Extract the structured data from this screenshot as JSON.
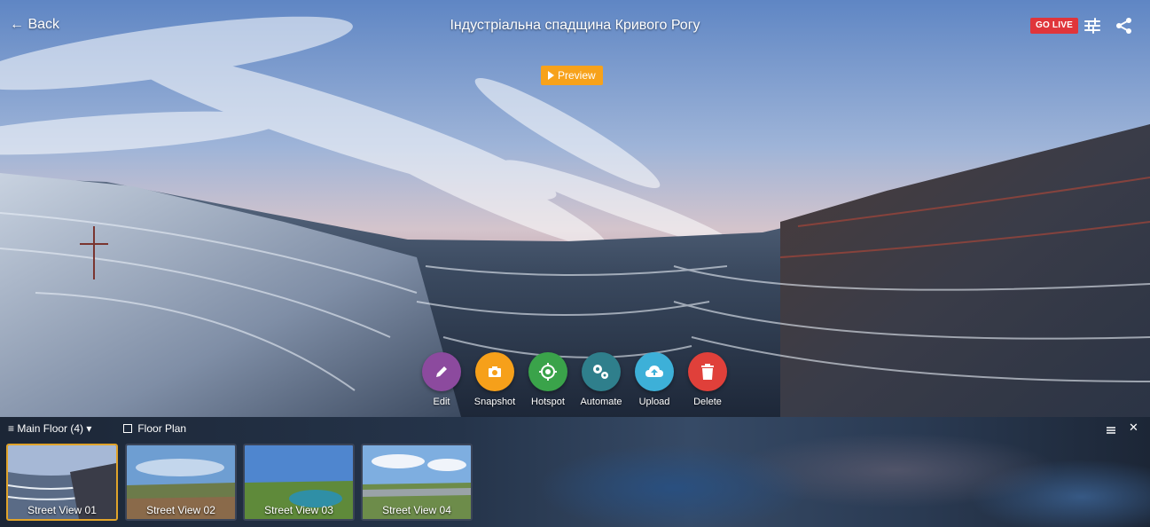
{
  "header": {
    "back_label": "← Back",
    "title": "Індустріальна спадщина Кривого Рогу",
    "go_live_label": "GO LIVE"
  },
  "preview_label": "Preview",
  "actions": [
    {
      "label": "Edit",
      "icon": "pencil-icon",
      "color": "#8c4a9e"
    },
    {
      "label": "Snapshot",
      "icon": "camera-icon",
      "color": "#f6a01a"
    },
    {
      "label": "Hotspot",
      "icon": "target-icon",
      "color": "#3aa34a"
    },
    {
      "label": "Automate",
      "icon": "gears-icon",
      "color": "#2f7f8c"
    },
    {
      "label": "Upload",
      "icon": "cloud-upload-icon",
      "color": "#3db0d8"
    },
    {
      "label": "Delete",
      "icon": "trash-icon",
      "color": "#e0403a"
    }
  ],
  "panel": {
    "floor_select_label": "Main Floor (4)",
    "floor_plan_label": "Floor Plan",
    "thumbnails": [
      {
        "label": "Street View 01",
        "active": true
      },
      {
        "label": "Street View 02",
        "active": false
      },
      {
        "label": "Street View 03",
        "active": false
      },
      {
        "label": "Street View 04",
        "active": false
      }
    ]
  },
  "colors": {
    "go_live": "#e0353b",
    "preview": "#f7a21b",
    "active_thumb_border": "#e0a32a"
  }
}
